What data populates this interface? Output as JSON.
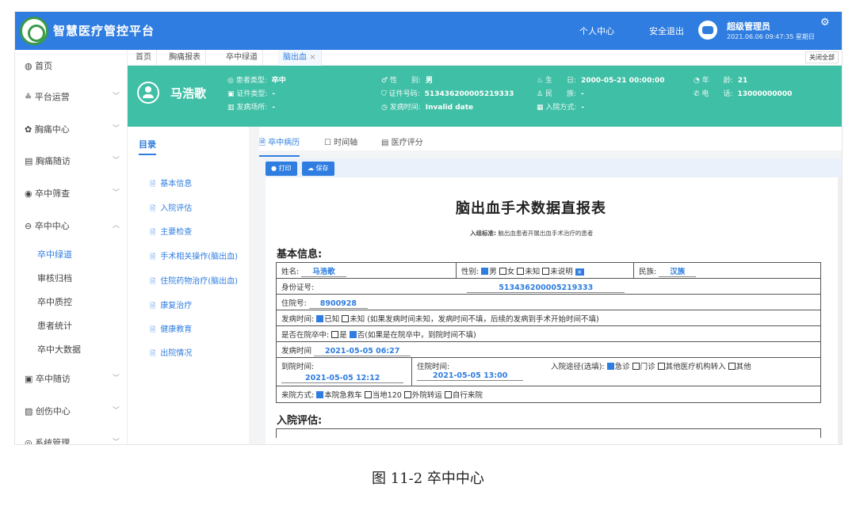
{
  "header": {
    "brand": "智慧医疗管控平台",
    "personal_center": "个人中心",
    "logout": "安全退出",
    "user_name": "超级管理员",
    "datetime": "2021.06.06 09:47:35 星期日",
    "settings_icon": "gear-icon"
  },
  "sidebar": {
    "items": [
      {
        "label": "首页",
        "icon": "home-icon"
      },
      {
        "label": "平台运营",
        "icon": "chart-icon"
      },
      {
        "label": "胸痛中心",
        "icon": "heart-icon"
      },
      {
        "label": "胸痛随访",
        "icon": "list-icon"
      },
      {
        "label": "卒中筛查",
        "icon": "screening-icon"
      },
      {
        "label": "卒中中心",
        "icon": "brain-icon"
      },
      {
        "label": "卒中随访",
        "icon": "followup-icon"
      },
      {
        "label": "创伤中心",
        "icon": "trauma-icon"
      },
      {
        "label": "系统管理",
        "icon": "system-icon"
      }
    ],
    "subitems": [
      "卒中绿道",
      "审核归档",
      "卒中质控",
      "患者统计",
      "卒中大数据"
    ]
  },
  "tabs": {
    "items": [
      "首页",
      "胸痛报表",
      "卒中绿道",
      "脑出血"
    ],
    "close_all": "关闭全部"
  },
  "patient": {
    "name": "马浩歌",
    "fields": [
      {
        "k": "患者类型:",
        "v": "卒中"
      },
      {
        "k": "证件类型:",
        "v": "-"
      },
      {
        "k": "发病场所:",
        "v": "-"
      },
      {
        "k": "性　　别:",
        "v": "男"
      },
      {
        "k": "证件号码:",
        "v": "513436200005219333"
      },
      {
        "k": "发病时间:",
        "v": "Invalid date"
      },
      {
        "k": "生　　日:",
        "v": "2000-05-21 00:00:00"
      },
      {
        "k": "民　　族:",
        "v": "-"
      },
      {
        "k": "入院方式:",
        "v": "-"
      },
      {
        "k": "年　　龄:",
        "v": "21"
      },
      {
        "k": "电　　话:",
        "v": "13000000000"
      }
    ]
  },
  "catalog": {
    "title": "目录",
    "items": [
      "基本信息",
      "入院评估",
      "主要检查",
      "手术相关操作(脑出血)",
      "住院药物治疗(脑出血)",
      "康复治疗",
      "健康教育",
      "出院情况"
    ]
  },
  "subtabs": [
    "卒中病历",
    "时间轴",
    "医疗评分"
  ],
  "toolbar": {
    "print": "打印",
    "save": "保存"
  },
  "document": {
    "title": "脑出血手术数据直报表",
    "criteria_label": "入组标准:",
    "criteria": "脑出血患者开展出血手术治疗的患者",
    "section_basic": "基本信息:",
    "section_admission": "入院评估:",
    "name_label": "姓名:",
    "name_value": "马浩歌",
    "gender_label": "性别:",
    "gender_options": [
      "男",
      "女",
      "未知",
      "未说明"
    ],
    "ethnic_label": "民族:",
    "ethnic_value": "汉族",
    "id_label": "身份证号:",
    "id_value": "513436200005219333",
    "admission_no_label": "住院号:",
    "admission_no_value": "8900928",
    "onset_label": "发病时间:",
    "onset_known": "已知",
    "onset_unknown": "未知",
    "onset_note": "(如果发病时间未知，发病时间不填，后续的发病到手术开始时间不填)",
    "in_hospital_label": "是否在院卒中:",
    "yes": "是",
    "no": "否",
    "in_hospital_note": "(如果是在院卒中，到院时间不填)",
    "onset_time_label": "发病时间",
    "onset_time_value": "2021-05-05 06:27",
    "arrive_label": "到院时间:",
    "arrive_value": "2021-05-05 12:12",
    "admit_label": "住院时间:",
    "admit_value": "2021-05-05 13:00",
    "route_label": "入院途径(选填):",
    "route_options": [
      "急诊",
      "门诊",
      "其他医疗机构转入",
      "其他"
    ],
    "arrival_mode_label": "来院方式:",
    "arrival_mode_options": [
      "本院急救车",
      "当地120",
      "外院转运",
      "自行来院"
    ]
  },
  "caption": "图 11-2 卒中中心",
  "colors": {
    "primary": "#2f7de0",
    "banner": "#3fbfa5"
  }
}
